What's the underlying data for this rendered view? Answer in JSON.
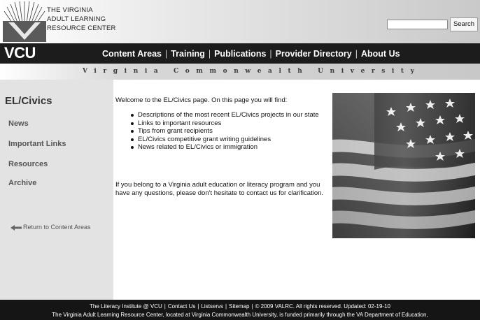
{
  "header": {
    "logo_lines": [
      "THE VIRGINIA",
      "ADULT LEARNING",
      "RESOURCE CENTER"
    ],
    "search": {
      "value": "",
      "placeholder": "",
      "button_label": "Search"
    }
  },
  "nav": {
    "vcu_logo": "VCU",
    "items": [
      "Content Areas",
      "Training",
      "Publications",
      "Provider Directory",
      "About Us"
    ],
    "separator": "|"
  },
  "university_band": "Virginia Commonwealth University",
  "sidebar": {
    "title": "EL/Civics",
    "links": [
      "News",
      "Important Links",
      "Resources",
      "Archive"
    ],
    "return_link": "Return to Content Areas"
  },
  "main": {
    "intro": "Welcome to the EL/Civics page. On this page you will find:",
    "bullets": [
      "Descriptions of the most recent EL/Civics projects in our state",
      "Links to important resources",
      "Tips from grant recipients",
      "EL/Civics competitive grant writing guidelines",
      "News related to EL/Civics or immigration"
    ],
    "closing": "If you belong to a Virginia adult education or literacy program and you have any questions, please don't hesitate to contact us for clarification."
  },
  "footer": {
    "links": [
      "The Literacy Institute @ VCU",
      "Contact Us",
      "Listservs",
      "Sitemap",
      "© 2009 VALRC. All rights reserved. Updated: 02-19-10"
    ],
    "note": "The Virginia Adult Learning Resource Center, located at Virginia Commonwealth University, is funded primarily through the VA Department of Education,"
  },
  "colors": {
    "nav_background": "#1c1c1c",
    "sidebar_background": "#e3e3e3",
    "footer_background": "#151515"
  },
  "icons": {
    "logo": "radiating-lines-logo-icon",
    "return_arrow": "arrow-left-icon",
    "photo": "american-flag-image"
  }
}
